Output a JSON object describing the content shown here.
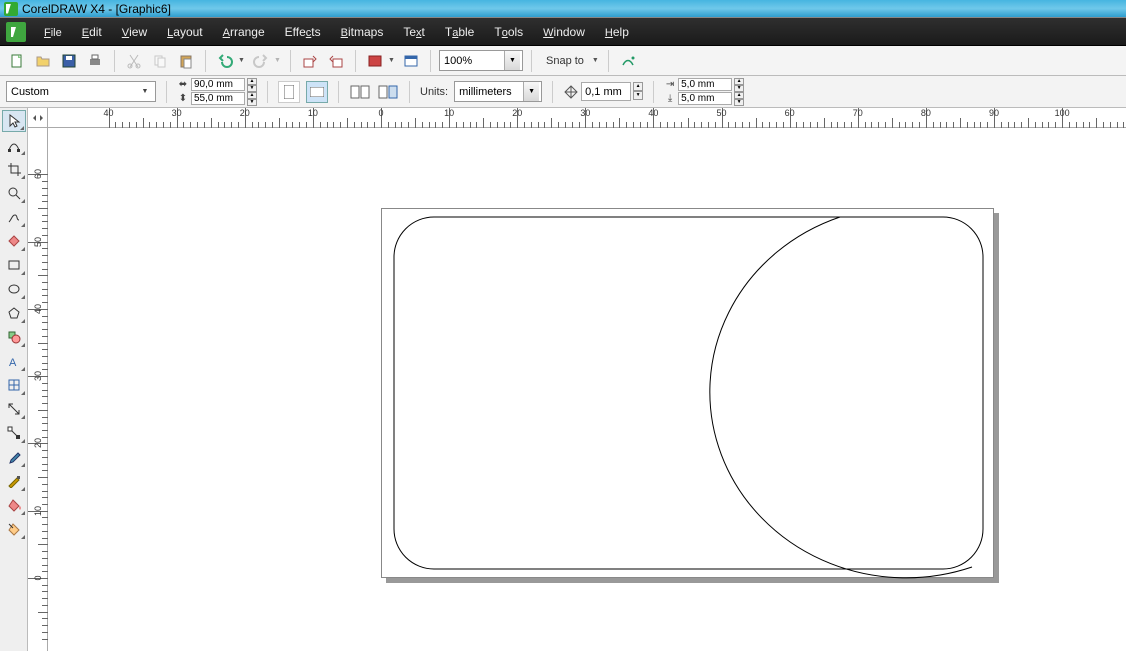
{
  "app": {
    "title": "CorelDRAW X4 - [Graphic6]"
  },
  "menu": {
    "items": [
      "File",
      "Edit",
      "View",
      "Layout",
      "Arrange",
      "Effects",
      "Bitmaps",
      "Text",
      "Table",
      "Tools",
      "Window",
      "Help"
    ]
  },
  "toolbar1": {
    "zoom": "100%",
    "snap_label": "Snap to"
  },
  "propbar": {
    "paper": "Custom",
    "width": "90,0 mm",
    "height": "55,0 mm",
    "units_label": "Units:",
    "units": "millimeters",
    "nudge": "0,1 mm",
    "dupx": "5,0 mm",
    "dupy": "5,0 mm"
  },
  "ruler": {
    "h_labels": [
      "40",
      "30",
      "20",
      "10",
      "0",
      "10",
      "20",
      "30",
      "40",
      "50",
      "60",
      "70",
      "80",
      "90",
      "100"
    ],
    "v_labels": [
      "60",
      "50",
      "40",
      "30",
      "20",
      "10",
      "0"
    ]
  }
}
